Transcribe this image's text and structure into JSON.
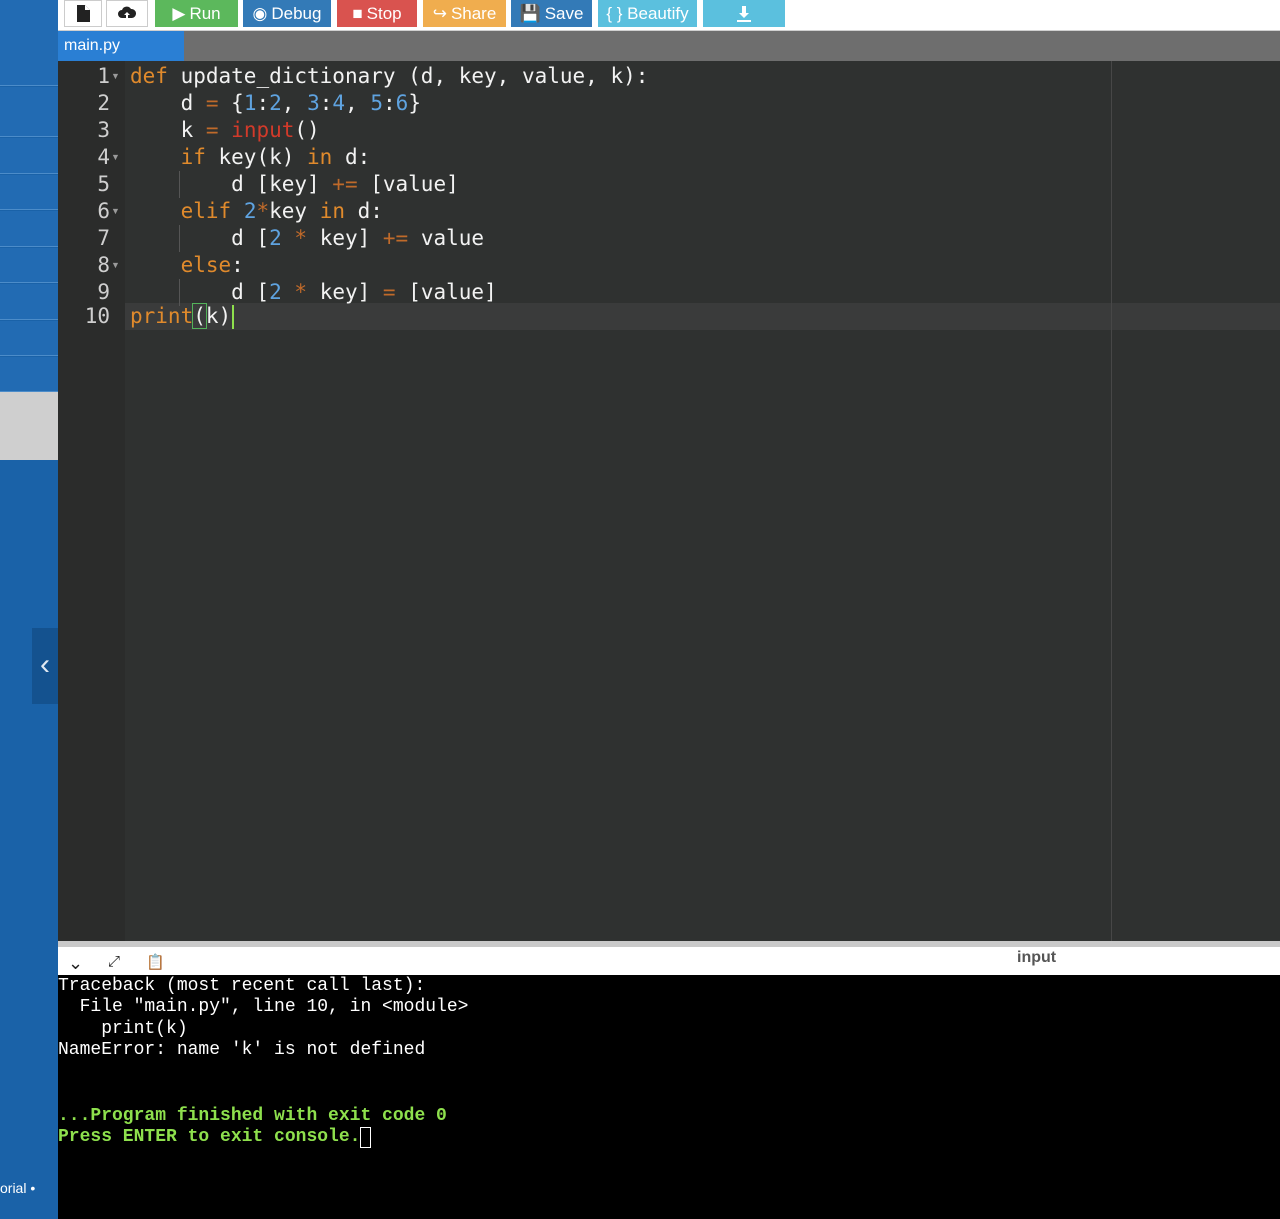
{
  "toolbar": {
    "new_file_icon": "file-icon",
    "upload_icon": "cloud-upload-icon",
    "run": {
      "label": "Run",
      "color": "#5cb85c"
    },
    "debug": {
      "label": "Debug",
      "color": "#337ab7"
    },
    "stop": {
      "label": "Stop",
      "color": "#d9534f"
    },
    "share": {
      "label": "Share",
      "color": "#f0ad4e"
    },
    "save": {
      "label": "Save",
      "color": "#337ab7"
    },
    "beautify": {
      "label": "{ } Beautify",
      "color": "#5bc0de"
    },
    "download_icon": "download-icon"
  },
  "tabs": [
    {
      "label": "main.py",
      "active": true
    }
  ],
  "editor": {
    "line_numbers": [
      "1",
      "2",
      "3",
      "4",
      "5",
      "6",
      "7",
      "8",
      "9",
      "10"
    ],
    "lines": [
      "def update_dictionary (d, key, value, k):",
      "    d = {1:2, 3:4, 5:6}",
      "    k = input()",
      "    if key(k) in d:",
      "        d [key] += [value]",
      "    elif 2*key in d:",
      "        d [2 * key] += value",
      "    else:",
      "        d [2 * key] = [value]",
      "print(k)"
    ],
    "active_line": 10
  },
  "console": {
    "input_label": "input",
    "output": [
      "Traceback (most recent call last):",
      "  File \"main.py\", line 10, in <module>",
      "    print(k)",
      "NameError: name 'k' is not defined"
    ],
    "finish_line": "...Program finished with exit code 0",
    "exit_prompt": "Press ENTER to exit console."
  },
  "sidebar": {
    "footer_text": "orial •"
  }
}
